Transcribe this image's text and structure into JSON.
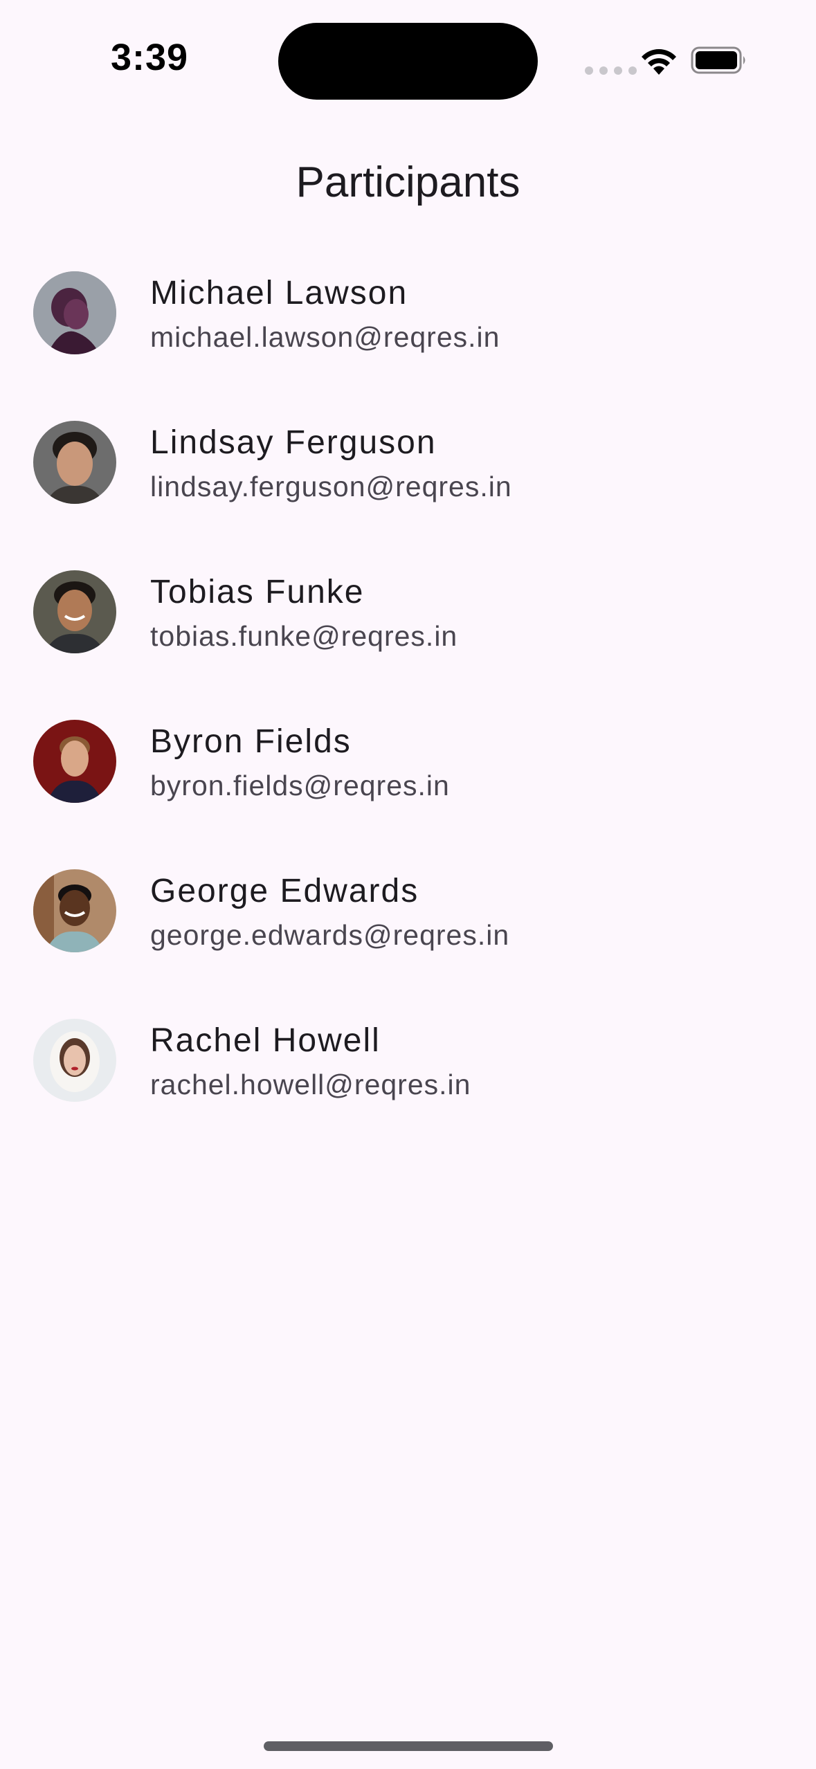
{
  "status_bar": {
    "time": "3:39"
  },
  "header": {
    "title": "Participants"
  },
  "participants": [
    {
      "name": "Michael Lawson",
      "email": "michael.lawson@reqres.in",
      "avatar": "avatar-michael-lawson"
    },
    {
      "name": "Lindsay Ferguson",
      "email": "lindsay.ferguson@reqres.in",
      "avatar": "avatar-lindsay-ferguson"
    },
    {
      "name": "Tobias Funke",
      "email": "tobias.funke@reqres.in",
      "avatar": "avatar-tobias-funke"
    },
    {
      "name": "Byron Fields",
      "email": "byron.fields@reqres.in",
      "avatar": "avatar-byron-fields"
    },
    {
      "name": "George Edwards",
      "email": "george.edwards@reqres.in",
      "avatar": "avatar-george-edwards"
    },
    {
      "name": "Rachel Howell",
      "email": "rachel.howell@reqres.in",
      "avatar": "avatar-rachel-howell"
    }
  ],
  "icons": {
    "wifi": "wifi-icon",
    "battery": "battery-icon",
    "signal": "cellular-signal-icon"
  },
  "colors": {
    "background": "#fdf7fd",
    "text_primary": "#1d1b20",
    "text_secondary": "#49454f"
  }
}
